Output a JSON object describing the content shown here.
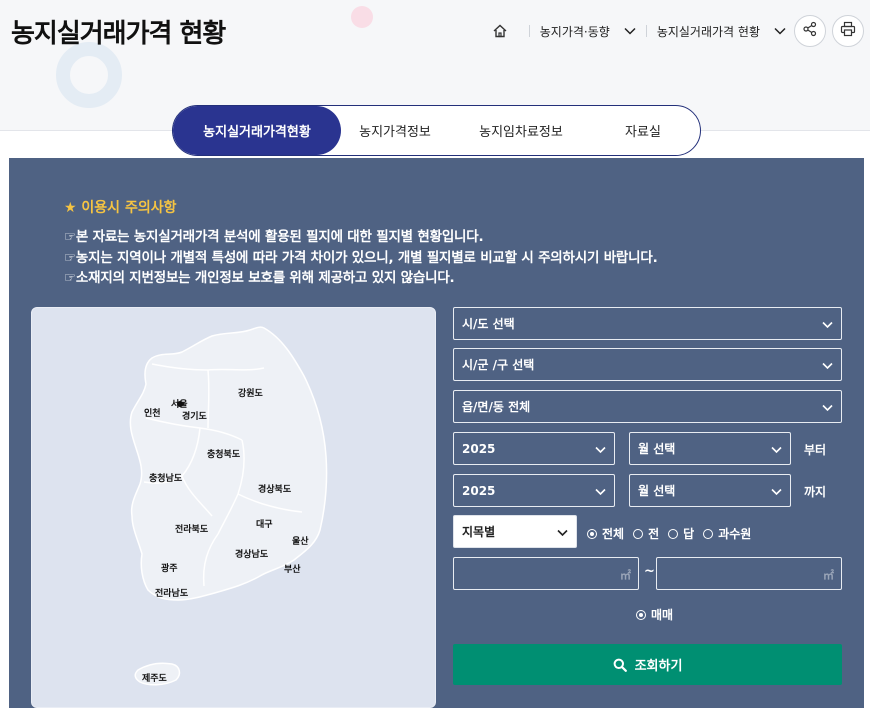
{
  "header": {
    "title": "농지실거래가격 현황",
    "breadcrumb": [
      "농지가격·동향",
      "농지실거래가격 현황"
    ]
  },
  "tabs": [
    {
      "label": "농지실거래가격현황",
      "active": true
    },
    {
      "label": "농지가격정보",
      "active": false
    },
    {
      "label": "농지임차료정보",
      "active": false
    },
    {
      "label": "자료실",
      "active": false
    }
  ],
  "notice": {
    "title": "★ 이용시 주의사항",
    "lines": [
      "☞본 자료는 농지실거래가격 분석에 활용된 필지에 대한 필지별 현황입니다.",
      "☞농지는 지역이나 개별적 특성에 따라 가격 차이가 있으니, 개별 필지별로 비교할 시 주의하시기 바랍니다.",
      "☞소재지의 지번정보는 개인정보 보호를 위해 제공하고 있지 않습니다."
    ]
  },
  "map": {
    "regions": [
      "서울",
      "인천",
      "경기도",
      "강원도",
      "충청북도",
      "충청남도",
      "경상북도",
      "대구",
      "전라북도",
      "울산",
      "경상남도",
      "광주",
      "부산",
      "전라남도",
      "제주도"
    ]
  },
  "form": {
    "sido": "시/도 선택",
    "sigungu": "시/군 /구 선택",
    "eupmyeondong": "읍/면/동 전체",
    "from_year": "2025",
    "from_month": "월 선택",
    "from_label": "부터",
    "to_year": "2025",
    "to_month": "월 선택",
    "to_label": "까지",
    "land_type": "지목별",
    "land_options": [
      {
        "label": "전체",
        "checked": true
      },
      {
        "label": "전",
        "checked": false
      },
      {
        "label": "답",
        "checked": false
      },
      {
        "label": "과수원",
        "checked": false
      }
    ],
    "area_unit": "㎡",
    "area_sep": "~",
    "deal_type": {
      "label": "매매",
      "checked": true
    },
    "search_label": "조회하기"
  },
  "colors": {
    "panel": "#4f6283",
    "tab_active": "#2a3490",
    "notice_title": "#f6c442",
    "search_button": "#008f72"
  }
}
